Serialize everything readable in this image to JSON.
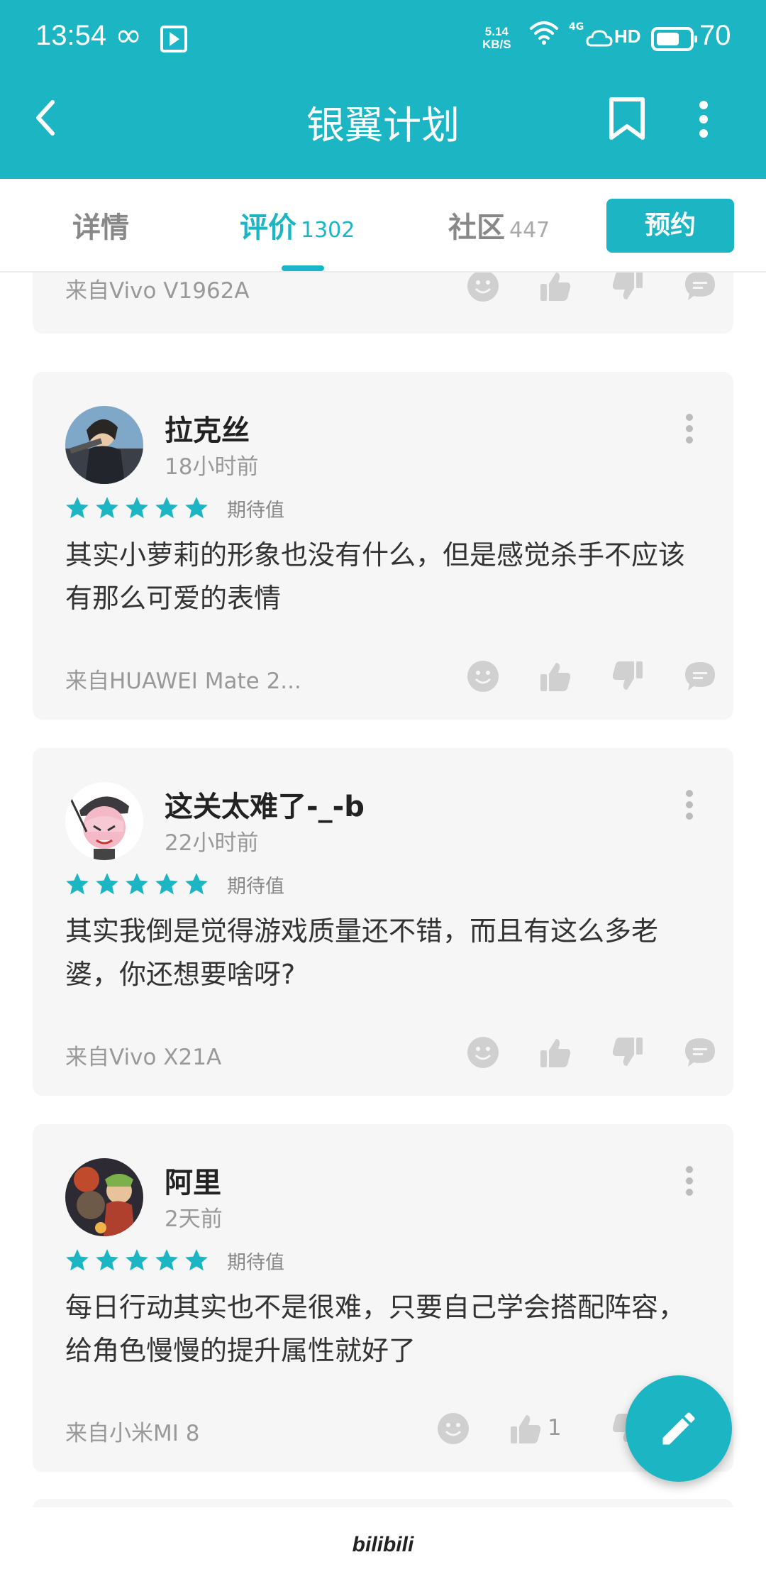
{
  "status_bar": {
    "time": "13:54",
    "net_speed_value": "5.14",
    "net_speed_unit": "KB/S",
    "network": "4G",
    "hd": "HD",
    "battery": "70",
    "battery_level": 0.7
  },
  "header": {
    "title": "银翼计划"
  },
  "tabs": [
    {
      "label": "详情",
      "count": ""
    },
    {
      "label": "评价",
      "count": "1302"
    },
    {
      "label": "社区",
      "count": "447"
    }
  ],
  "reserve_label": "预约",
  "expect_label": "期待值",
  "partial_card": {
    "from": "来自Vivo V1962A"
  },
  "reviews": [
    {
      "user": "拉克丝",
      "time": "18小时前",
      "rating": 5,
      "text": "其实小萝莉的形象也没有什么，但是感觉杀手不应该有那么可爱的表情",
      "from": "来自HUAWEI Mate 2...",
      "likes": ""
    },
    {
      "user": "这关太难了-_-b",
      "time": "22小时前",
      "rating": 5,
      "text": "其实我倒是觉得游戏质量还不错，而且有这么多老婆，你还想要啥呀?",
      "from": "来自Vivo X21A",
      "likes": ""
    },
    {
      "user": "阿里",
      "time": "2天前",
      "rating": 5,
      "text": "每日行动其实也不是很难，只要自己学会搭配阵容，给角色慢慢的提升属性就好了",
      "from": "来自小米MI 8",
      "likes": "1"
    }
  ],
  "bottom_brand": "bilibili",
  "colors": {
    "accent": "#1CB5C3",
    "card_bg": "#F6F6F6",
    "icon_gray": "#D0D0D0"
  },
  "icons": [
    "back-icon",
    "bookmark-icon",
    "more-vert-icon",
    "star-icon",
    "emoji-icon",
    "thumb-up-icon",
    "thumb-down-icon",
    "comment-icon",
    "edit-icon"
  ]
}
